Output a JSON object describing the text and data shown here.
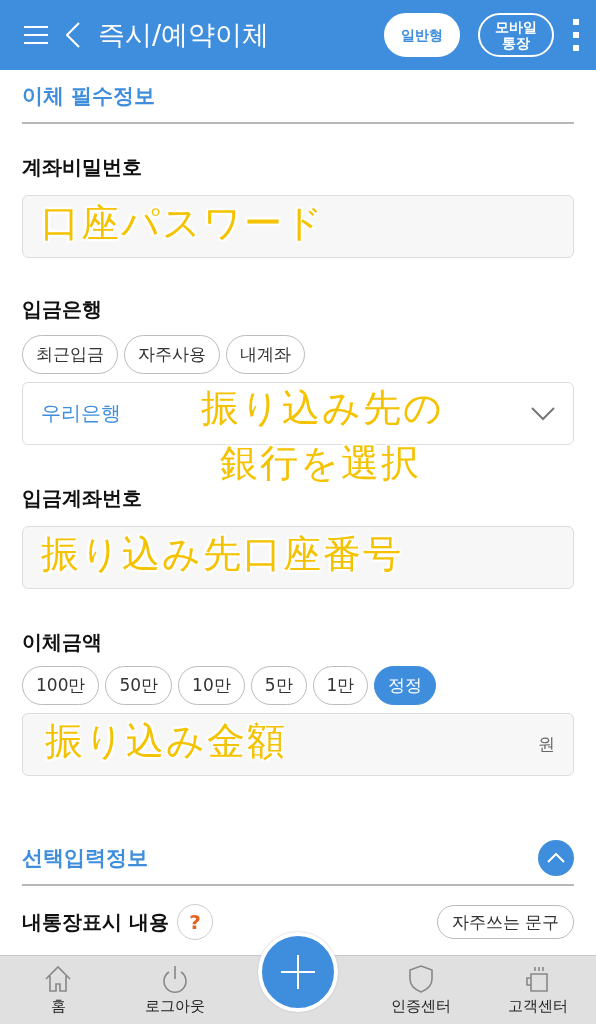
{
  "header": {
    "title": "즉시/예약이체",
    "buttons": [
      {
        "label": "일반형",
        "selected": true
      },
      {
        "label": "모바일 통장",
        "selected": false
      }
    ]
  },
  "required_section": {
    "title": "이체 필수정보",
    "password": {
      "label": "계좌비밀번호",
      "annotation": "口座パスワード"
    },
    "bank": {
      "label": "입금은행",
      "chips": [
        {
          "label": "최근입금",
          "selected": false
        },
        {
          "label": "자주사용",
          "selected": false
        },
        {
          "label": "내계좌",
          "selected": false
        }
      ],
      "value": "우리은행",
      "annotation_lines": [
        "振り込み先の",
        "銀行を選択"
      ]
    },
    "account": {
      "label": "입금계좌번호",
      "annotation": "振り込み先口座番号"
    },
    "amount": {
      "label": "이체금액",
      "chips": [
        {
          "label": "100만",
          "selected": false
        },
        {
          "label": "50만",
          "selected": false
        },
        {
          "label": "10만",
          "selected": false
        },
        {
          "label": "5만",
          "selected": false
        },
        {
          "label": "1만",
          "selected": false
        },
        {
          "label": "정정",
          "selected": true
        }
      ],
      "unit": "원",
      "annotation": "振り込み金額"
    }
  },
  "optional_section": {
    "title": "선택입력정보",
    "expanded": true,
    "memo_label": "내통장표시 내용",
    "help": "?",
    "phrase_button": "자주쓰는 문구"
  },
  "bottom_nav": [
    {
      "label": "홈",
      "kind": "home"
    },
    {
      "label": "로그아웃",
      "kind": "power"
    },
    {
      "label": "인증센터",
      "kind": "shield"
    },
    {
      "label": "고객센터",
      "kind": "cup"
    }
  ]
}
